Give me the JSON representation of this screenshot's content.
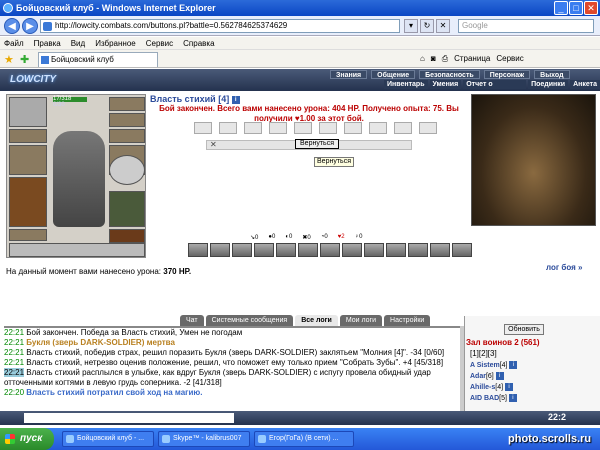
{
  "window": {
    "title": "Бойцовский клуб - Windows Internet Explorer"
  },
  "address": {
    "url": "http://lowcity.combats.com/buttons.pl?battle=0.562784625374629"
  },
  "search": {
    "placeholder": "Google"
  },
  "menu": [
    "Файл",
    "Правка",
    "Вид",
    "Избранное",
    "Сервис",
    "Справка"
  ],
  "tab": {
    "title": "Бойцовский клуб"
  },
  "ie_tools": {
    "page": "Страница",
    "service": "Сервис"
  },
  "game": {
    "logo": "LOWCITY",
    "topnav": [
      "Знания",
      "Общение",
      "Безопасность",
      "Персонаж",
      "Выход"
    ],
    "subnav": [
      "Инвентарь",
      "Умения",
      "Отчет о переводах",
      "Поединки",
      "Анкета"
    ]
  },
  "character": {
    "hp": "17/318",
    "mp": "0/30"
  },
  "battle": {
    "opponent": "Власть стихий",
    "opponent_level": "[4]",
    "info_badge": "i",
    "result_line1": "Бой закончен. Всего вами нанесено урона: 404 HP. Получено опыта: 75. Вы",
    "result_line2": "получили",
    "bonus": "1.00",
    "result_line3": "за этот бой.",
    "back_button": "Вернуться",
    "tooltip": "Вернуться",
    "close_glyph": "✕",
    "stats": [
      "0",
      "0",
      "0",
      "0",
      "0",
      "2",
      "0"
    ],
    "damage_label": "На данный момент вами нанесено урона:",
    "damage_value": "370 HP.",
    "log_link": "лог боя »"
  },
  "chat": {
    "tabs": [
      "Чат",
      "Системные сообщения",
      "Все логи",
      "Мои логи",
      "Настройки"
    ],
    "active_tab": "Все логи",
    "lines": [
      {
        "time": "22:21",
        "text": "Бой закончен. Победа за Власть стихий, Умен не погодам"
      },
      {
        "time": "22:21",
        "text": "Букля (зверь DARK-SOLDIER) мертва"
      },
      {
        "time": "22:21",
        "text": "Власть стихий, победив страх, решил поразить Букля (зверь DARK-SOLDIER) заклятьем \"Молния [4]\". -34 [0/60]"
      },
      {
        "time": "22:21",
        "text": "Власть стихий, нетрезво оценив положение, решил, что поможет ему только прием \"Собрать Зубы\". +4 [45/318]"
      },
      {
        "time": "22:21",
        "text": "Власть стихий расплылся в улыбке, как вдруг Букля (зверь DARK-SOLDIER) с испугу провела обидный удар отточенными когтями в левую грудь соперника. -2 [41/318]"
      },
      {
        "time": "22:20",
        "text": "Власть стихий потратил свой ход на магию."
      }
    ]
  },
  "online": {
    "refresh": "Обновить",
    "room": "Зал воинов 2 (561)",
    "pages": "[1][2][3]",
    "users": [
      {
        "name": "A Sistem",
        "level": "[4]"
      },
      {
        "name": "Adar",
        "level": "[6]"
      },
      {
        "name": "Ahille-s",
        "level": "[4]"
      },
      {
        "name": "AID BAD",
        "level": "[5]"
      }
    ]
  },
  "clock": "22:2",
  "taskbar": {
    "start": "пуск",
    "tasks": [
      "Бойцовский клуб - ...",
      "Skype™ - kalibrus007",
      "Егор(ГоГа) (В сети) ..."
    ]
  },
  "watermark": "photo.scrolls.ru",
  "colors": {
    "titlebar": "#0a46c4",
    "result": "#bb0000",
    "name": "#3a6ac8",
    "taskbar": "#2458d8"
  }
}
